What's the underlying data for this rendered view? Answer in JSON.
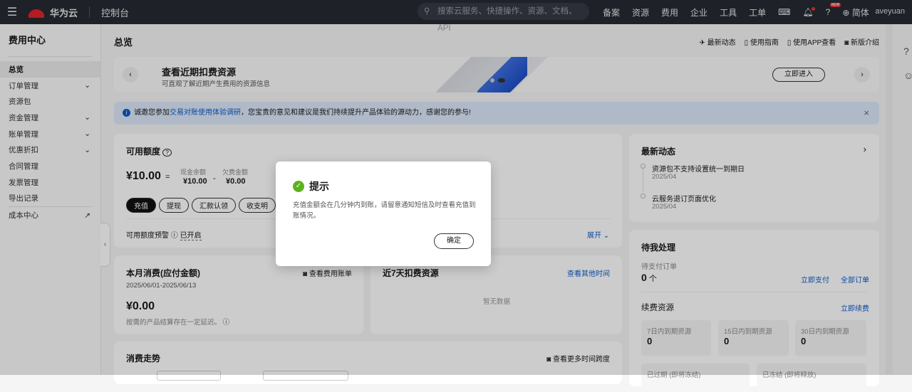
{
  "nav": {
    "brand": "华为云",
    "logo_text": "HUAWEI",
    "console": "控制台",
    "search_placeholder": "搜索云服务、快捷操作、资源、文档、API",
    "links": [
      "备案",
      "资源",
      "费用",
      "企业",
      "工具",
      "工单"
    ],
    "new_badge": "NEW",
    "language": "简体",
    "user": "aveyuan"
  },
  "sidebar": {
    "title": "费用中心",
    "items": [
      {
        "label": "总览",
        "active": true
      },
      {
        "label": "订单管理",
        "chevron": true
      },
      {
        "label": "资源包"
      },
      {
        "label": "资金管理",
        "chevron": true
      },
      {
        "label": "账单管理",
        "chevron": true
      },
      {
        "label": "优惠折扣",
        "chevron": true
      },
      {
        "label": "合同管理"
      },
      {
        "label": "发票管理"
      },
      {
        "label": "导出记录"
      }
    ],
    "external": "成本中心"
  },
  "page": {
    "title": "总览",
    "actions": [
      "最新动态",
      "使用指南",
      "使用APP查看",
      "新版介绍"
    ]
  },
  "banner": {
    "title": "查看近期扣费资源",
    "subtitle": "可直观了解近期产生费用的资源信息",
    "button": "立即进入"
  },
  "notice": {
    "prefix": "诚邀您参加",
    "link": "交易对账使用体验调研",
    "suffix": "，您宝贵的意见和建议是我们持续提升产品体验的源动力，感谢您的参与!"
  },
  "quota": {
    "title": "可用额度",
    "total": "¥10.00",
    "eq": "=",
    "cash_label": "现金余额",
    "cash": "¥10.00",
    "minus": "-",
    "debt_label": "欠费金额",
    "debt": "¥0.00",
    "buttons": [
      "充值",
      "提现",
      "汇款认领",
      "收支明"
    ],
    "alert_label": "可用额度预警",
    "alert_status": "已开启",
    "expand": "展开"
  },
  "monthly": {
    "title": "本月消费(应付金额)",
    "link": "查看费用账单",
    "range": "2025/06/01-2025/06/13",
    "amount": "¥0.00",
    "note": "按需的产品结算存在一定延迟。"
  },
  "recent7": {
    "title": "近7天扣费资源",
    "link": "查看其他时间",
    "empty": "暂无数据"
  },
  "trend": {
    "title": "消费走势",
    "link": "查看更多时间跨度"
  },
  "news": {
    "title": "最新动态",
    "items": [
      {
        "text": "资源包不支持设置统一到期日",
        "date": "2025/04"
      },
      {
        "text": "云服务退订页面优化",
        "date": "2025/04"
      }
    ]
  },
  "todo": {
    "title": "待我处理",
    "pending_label": "待支付订单",
    "pending_count": "0",
    "unit": "个",
    "pay": "立即支付",
    "all_orders": "全部订单",
    "renew_title": "续费资源",
    "renew_link": "立即续费",
    "boxes": [
      {
        "label": "7日内到期资源",
        "value": "0"
      },
      {
        "label": "15日内到期资源",
        "value": "0"
      },
      {
        "label": "30日内到期资源",
        "value": "0"
      }
    ],
    "bottom": [
      "已过期 (即将冻结)",
      "已冻结 (即将释放)"
    ]
  },
  "modal": {
    "title": "提示",
    "body": "充值金额会在几分钟内到账，请留意通知短信及时查看充值到账情况。",
    "ok": "确定"
  }
}
